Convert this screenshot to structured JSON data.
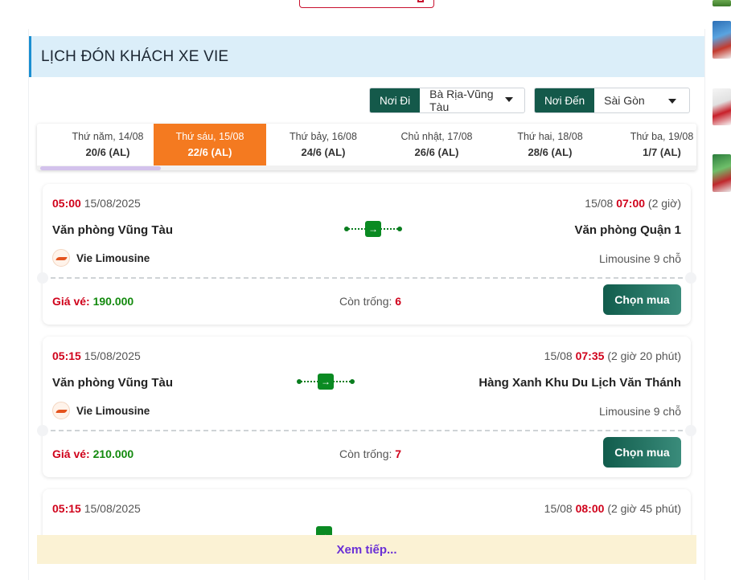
{
  "section": {
    "title": "LỊCH ĐÓN KHÁCH XE VIE"
  },
  "filters": {
    "from": {
      "label": "Nơi Đi",
      "value": "Bà Rịa-Vũng Tàu"
    },
    "to": {
      "label": "Nơi Đến",
      "value": "Sài Gòn"
    }
  },
  "dates": [
    {
      "day": "Thứ năm, 14/08",
      "lunar": "20/6 (AL)",
      "active": false
    },
    {
      "day": "Thứ sáu, 15/08",
      "lunar": "22/6 (AL)",
      "active": true
    },
    {
      "day": "Thứ bảy, 16/08",
      "lunar": "24/6 (AL)",
      "active": false
    },
    {
      "day": "Chủ nhật, 17/08",
      "lunar": "26/6 (AL)",
      "active": false
    },
    {
      "day": "Thứ hai, 18/08",
      "lunar": "28/6 (AL)",
      "active": false
    },
    {
      "day": "Thứ ba, 19/08",
      "lunar": "1/7 (AL)",
      "active": false
    }
  ],
  "labels": {
    "price": "Giá vé: ",
    "seats": "Còn trống: ",
    "buy": "Chọn mua",
    "more": "Xem tiếp..."
  },
  "trips": [
    {
      "dep_time": "05:00",
      "dep_date": "15/08/2025",
      "arr_date": "15/08",
      "arr_time": "07:00",
      "duration": "(2 giờ)",
      "from": "Văn phòng Vũng Tàu",
      "to": "Văn phòng Quận 1",
      "operator": "Vie Limousine",
      "vehicle": "Limousine 9 chỗ",
      "price": "190.000",
      "seats": "6"
    },
    {
      "dep_time": "05:15",
      "dep_date": "15/08/2025",
      "arr_date": "15/08",
      "arr_time": "07:35",
      "duration": "(2 giờ 20 phút)",
      "from": "Văn phòng Vũng Tàu",
      "to": "Hàng Xanh Khu Du Lịch Văn Thánh",
      "operator": "Vie Limousine",
      "vehicle": "Limousine 9 chỗ",
      "price": "210.000",
      "seats": "7"
    },
    {
      "dep_time": "05:15",
      "dep_date": "15/08/2025",
      "arr_date": "15/08",
      "arr_time": "08:00",
      "duration": "(2 giờ 45 phút)"
    }
  ],
  "icons": {
    "route": "bus-route-icon",
    "operator_logo": "vie-limousine-logo",
    "dropdown": "caret-down-icon"
  },
  "colors": {
    "accent_orange": "#f47a20",
    "brand_green": "#14594a",
    "time_red": "#d0021b",
    "price_green": "#138a0e",
    "more_purple": "#6a30d6"
  }
}
